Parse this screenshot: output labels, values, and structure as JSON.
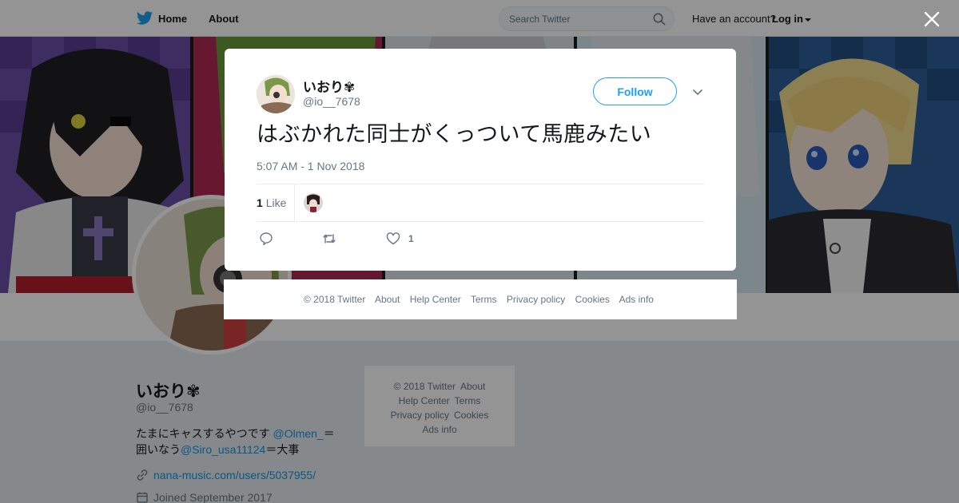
{
  "nav": {
    "home_label": "Home",
    "about_label": "About",
    "search_placeholder": "Search Twitter",
    "have_account": "Have an account?",
    "login_label": "Log in"
  },
  "profile": {
    "name": "いおり✾",
    "handle": "@io__7678",
    "bio_part1": "たまにキャスするやつです",
    "bio_link1": "@Olmen_",
    "bio_part2": "＝囲いなう",
    "bio_link2": "@Siro_usa11124",
    "bio_part3": "＝大事",
    "url": "nana-music.com/users/5037955/",
    "joined": "Joined September 2017"
  },
  "side_footer": {
    "copyright": "© 2018 Twitter",
    "about": "About",
    "help": "Help Center",
    "terms": "Terms",
    "privacy": "Privacy policy",
    "cookies": "Cookies",
    "ads": "Ads info"
  },
  "tweet": {
    "name": "いおり✾",
    "handle": "@io__7678",
    "follow_label": "Follow",
    "text": "はぶかれた同士がくっついて馬鹿みたい",
    "timestamp": "5:07 AM - 1 Nov 2018",
    "likes_count": "1",
    "likes_label": "Like",
    "like_action_count": "1"
  },
  "modal_footer": {
    "copyright": "© 2018 Twitter",
    "about": "About",
    "help": "Help Center",
    "terms": "Terms",
    "privacy": "Privacy policy",
    "cookies": "Cookies",
    "ads": "Ads info"
  },
  "icons": {
    "brand": "twitter-bird-icon",
    "search": "search-icon",
    "close": "close-icon",
    "reply": "reply-icon",
    "retweet": "retweet-icon",
    "like": "heart-icon",
    "link": "link-icon",
    "calendar": "calendar-icon",
    "caret": "chevron-down-icon"
  },
  "colors": {
    "brand": "#1da1f2",
    "link": "#1b95e0",
    "text": "#14171a",
    "muted": "#657786",
    "page_bg": "#e6ecf0"
  }
}
